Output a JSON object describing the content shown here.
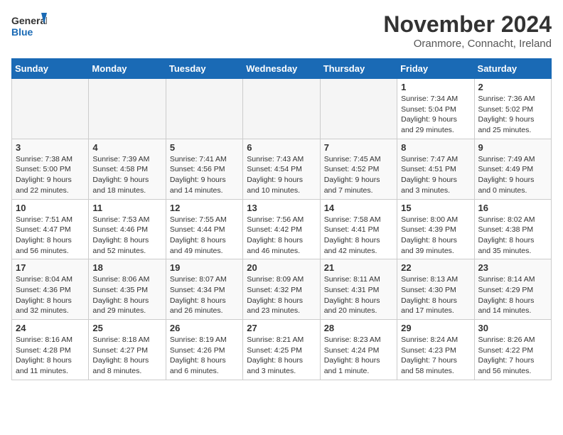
{
  "header": {
    "logo_general": "General",
    "logo_blue": "Blue",
    "month_title": "November 2024",
    "location": "Oranmore, Connacht, Ireland"
  },
  "days_of_week": [
    "Sunday",
    "Monday",
    "Tuesday",
    "Wednesday",
    "Thursday",
    "Friday",
    "Saturday"
  ],
  "weeks": [
    [
      {
        "day": "",
        "info": ""
      },
      {
        "day": "",
        "info": ""
      },
      {
        "day": "",
        "info": ""
      },
      {
        "day": "",
        "info": ""
      },
      {
        "day": "",
        "info": ""
      },
      {
        "day": "1",
        "info": "Sunrise: 7:34 AM\nSunset: 5:04 PM\nDaylight: 9 hours and 29 minutes."
      },
      {
        "day": "2",
        "info": "Sunrise: 7:36 AM\nSunset: 5:02 PM\nDaylight: 9 hours and 25 minutes."
      }
    ],
    [
      {
        "day": "3",
        "info": "Sunrise: 7:38 AM\nSunset: 5:00 PM\nDaylight: 9 hours and 22 minutes."
      },
      {
        "day": "4",
        "info": "Sunrise: 7:39 AM\nSunset: 4:58 PM\nDaylight: 9 hours and 18 minutes."
      },
      {
        "day": "5",
        "info": "Sunrise: 7:41 AM\nSunset: 4:56 PM\nDaylight: 9 hours and 14 minutes."
      },
      {
        "day": "6",
        "info": "Sunrise: 7:43 AM\nSunset: 4:54 PM\nDaylight: 9 hours and 10 minutes."
      },
      {
        "day": "7",
        "info": "Sunrise: 7:45 AM\nSunset: 4:52 PM\nDaylight: 9 hours and 7 minutes."
      },
      {
        "day": "8",
        "info": "Sunrise: 7:47 AM\nSunset: 4:51 PM\nDaylight: 9 hours and 3 minutes."
      },
      {
        "day": "9",
        "info": "Sunrise: 7:49 AM\nSunset: 4:49 PM\nDaylight: 9 hours and 0 minutes."
      }
    ],
    [
      {
        "day": "10",
        "info": "Sunrise: 7:51 AM\nSunset: 4:47 PM\nDaylight: 8 hours and 56 minutes."
      },
      {
        "day": "11",
        "info": "Sunrise: 7:53 AM\nSunset: 4:46 PM\nDaylight: 8 hours and 52 minutes."
      },
      {
        "day": "12",
        "info": "Sunrise: 7:55 AM\nSunset: 4:44 PM\nDaylight: 8 hours and 49 minutes."
      },
      {
        "day": "13",
        "info": "Sunrise: 7:56 AM\nSunset: 4:42 PM\nDaylight: 8 hours and 46 minutes."
      },
      {
        "day": "14",
        "info": "Sunrise: 7:58 AM\nSunset: 4:41 PM\nDaylight: 8 hours and 42 minutes."
      },
      {
        "day": "15",
        "info": "Sunrise: 8:00 AM\nSunset: 4:39 PM\nDaylight: 8 hours and 39 minutes."
      },
      {
        "day": "16",
        "info": "Sunrise: 8:02 AM\nSunset: 4:38 PM\nDaylight: 8 hours and 35 minutes."
      }
    ],
    [
      {
        "day": "17",
        "info": "Sunrise: 8:04 AM\nSunset: 4:36 PM\nDaylight: 8 hours and 32 minutes."
      },
      {
        "day": "18",
        "info": "Sunrise: 8:06 AM\nSunset: 4:35 PM\nDaylight: 8 hours and 29 minutes."
      },
      {
        "day": "19",
        "info": "Sunrise: 8:07 AM\nSunset: 4:34 PM\nDaylight: 8 hours and 26 minutes."
      },
      {
        "day": "20",
        "info": "Sunrise: 8:09 AM\nSunset: 4:32 PM\nDaylight: 8 hours and 23 minutes."
      },
      {
        "day": "21",
        "info": "Sunrise: 8:11 AM\nSunset: 4:31 PM\nDaylight: 8 hours and 20 minutes."
      },
      {
        "day": "22",
        "info": "Sunrise: 8:13 AM\nSunset: 4:30 PM\nDaylight: 8 hours and 17 minutes."
      },
      {
        "day": "23",
        "info": "Sunrise: 8:14 AM\nSunset: 4:29 PM\nDaylight: 8 hours and 14 minutes."
      }
    ],
    [
      {
        "day": "24",
        "info": "Sunrise: 8:16 AM\nSunset: 4:28 PM\nDaylight: 8 hours and 11 minutes."
      },
      {
        "day": "25",
        "info": "Sunrise: 8:18 AM\nSunset: 4:27 PM\nDaylight: 8 hours and 8 minutes."
      },
      {
        "day": "26",
        "info": "Sunrise: 8:19 AM\nSunset: 4:26 PM\nDaylight: 8 hours and 6 minutes."
      },
      {
        "day": "27",
        "info": "Sunrise: 8:21 AM\nSunset: 4:25 PM\nDaylight: 8 hours and 3 minutes."
      },
      {
        "day": "28",
        "info": "Sunrise: 8:23 AM\nSunset: 4:24 PM\nDaylight: 8 hours and 1 minute."
      },
      {
        "day": "29",
        "info": "Sunrise: 8:24 AM\nSunset: 4:23 PM\nDaylight: 7 hours and 58 minutes."
      },
      {
        "day": "30",
        "info": "Sunrise: 8:26 AM\nSunset: 4:22 PM\nDaylight: 7 hours and 56 minutes."
      }
    ]
  ]
}
